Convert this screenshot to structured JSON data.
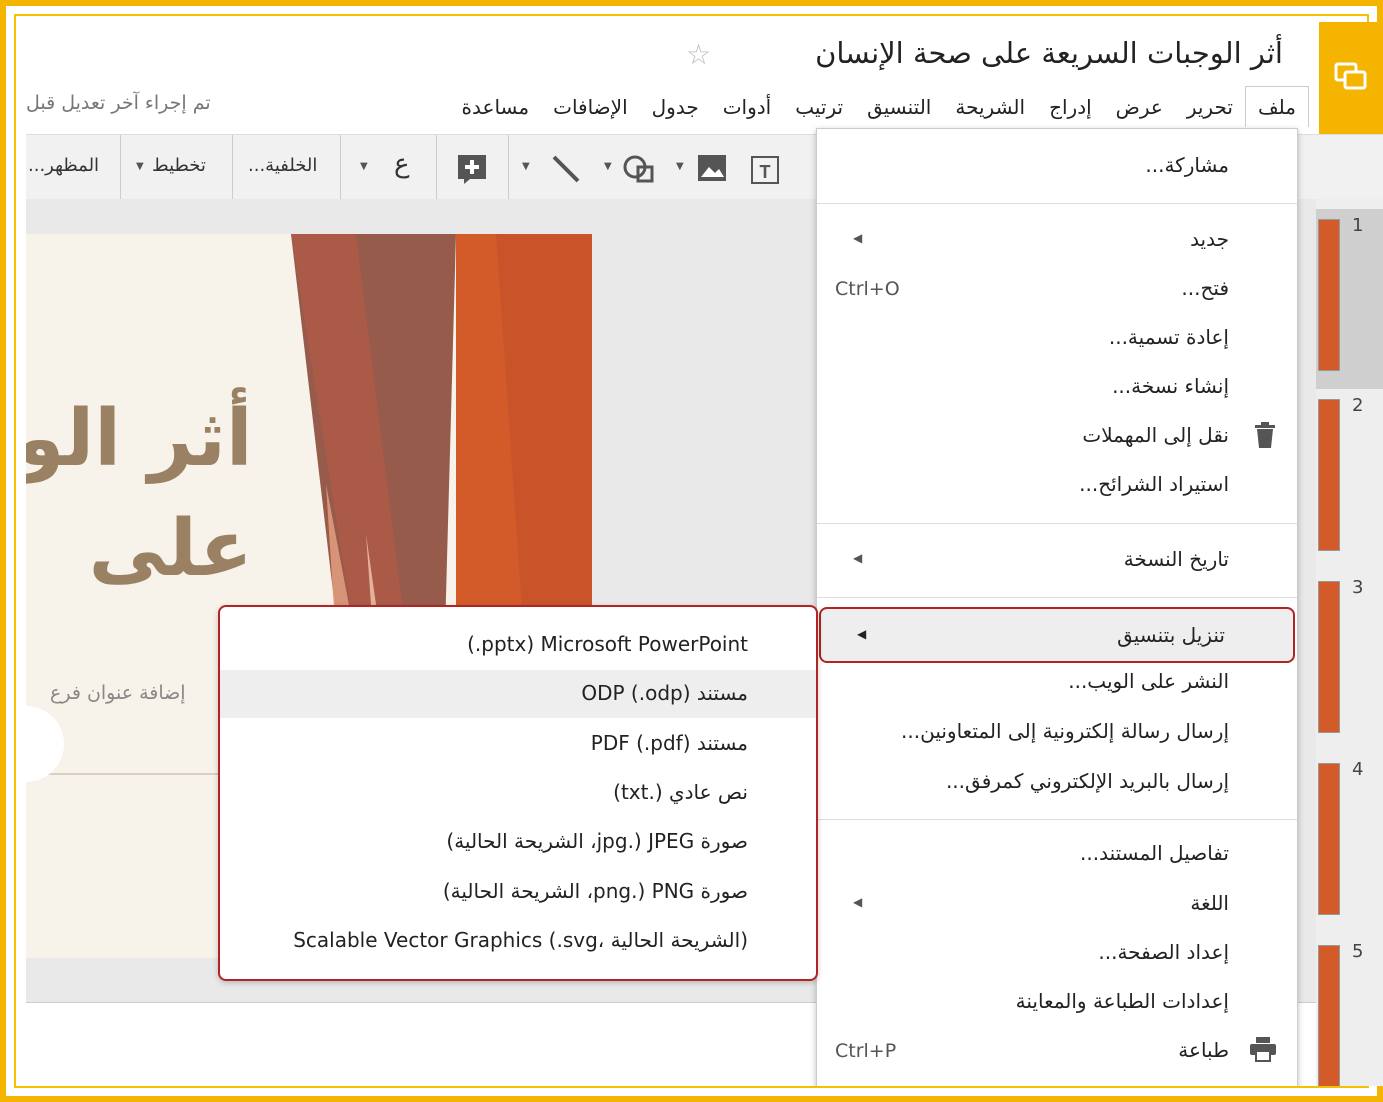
{
  "header": {
    "doc_title": "أثر الوجبات السريعة على صحة الإنسان",
    "star_icon": "star-outline-icon",
    "last_edit": "تم إجراء آخر تعديل قبل"
  },
  "menubar": [
    "ملف",
    "تحرير",
    "عرض",
    "إدراج",
    "الشريحة",
    "التنسيق",
    "ترتيب",
    "أدوات",
    "جدول",
    "الإضافات",
    "مساعدة"
  ],
  "toolbar": {
    "background": "الخلفية...",
    "layout": "تخطيط",
    "theme": "المظهر...",
    "text_glyph": "ع"
  },
  "slide": {
    "title_line1": "أثر الو",
    "title_line2": "على",
    "subtitle": "إضافة عنوان فرع",
    "title_color": "#9a8163",
    "accent_color": "#d35b2a"
  },
  "thumbnails": [
    "1",
    "2",
    "3",
    "4",
    "5"
  ],
  "file_menu": {
    "share": "مشاركة...",
    "new": "جديد",
    "open": "فتح...",
    "open_shortcut": "Ctrl+O",
    "rename": "إعادة تسمية...",
    "make_copy": "إنشاء نسخة...",
    "move_to_trash": "نقل إلى المهملات",
    "import_slides": "استيراد الشرائح...",
    "version_history": "تاريخ النسخة",
    "download_as": "تنزيل بتنسيق",
    "publish_web": "النشر على الويب...",
    "email_collaborators": "إرسال رسالة إلكترونية إلى المتعاونين...",
    "email_attachment": "إرسال بالبريد الإلكتروني كمرفق...",
    "doc_details": "تفاصيل المستند...",
    "language": "اللغة",
    "page_setup": "إعداد الصفحة...",
    "print_settings": "إعدادات الطباعة والمعاينة",
    "print": "طباعة",
    "print_shortcut": "Ctrl+P"
  },
  "download_submenu": [
    "(.pptx) Microsoft PowerPoint",
    "مستند ODP (.odp)",
    "مستند PDF (.pdf)",
    "نص عادي (.txt)",
    "صورة JPEG (.jpg، الشريحة الحالية)",
    "صورة PNG (.png، الشريحة الحالية)",
    "Scalable Vector Graphics (.svg، الشريحة الحالية)"
  ],
  "colors": {
    "frame": "#f5b400",
    "highlight_border": "#b02424"
  }
}
